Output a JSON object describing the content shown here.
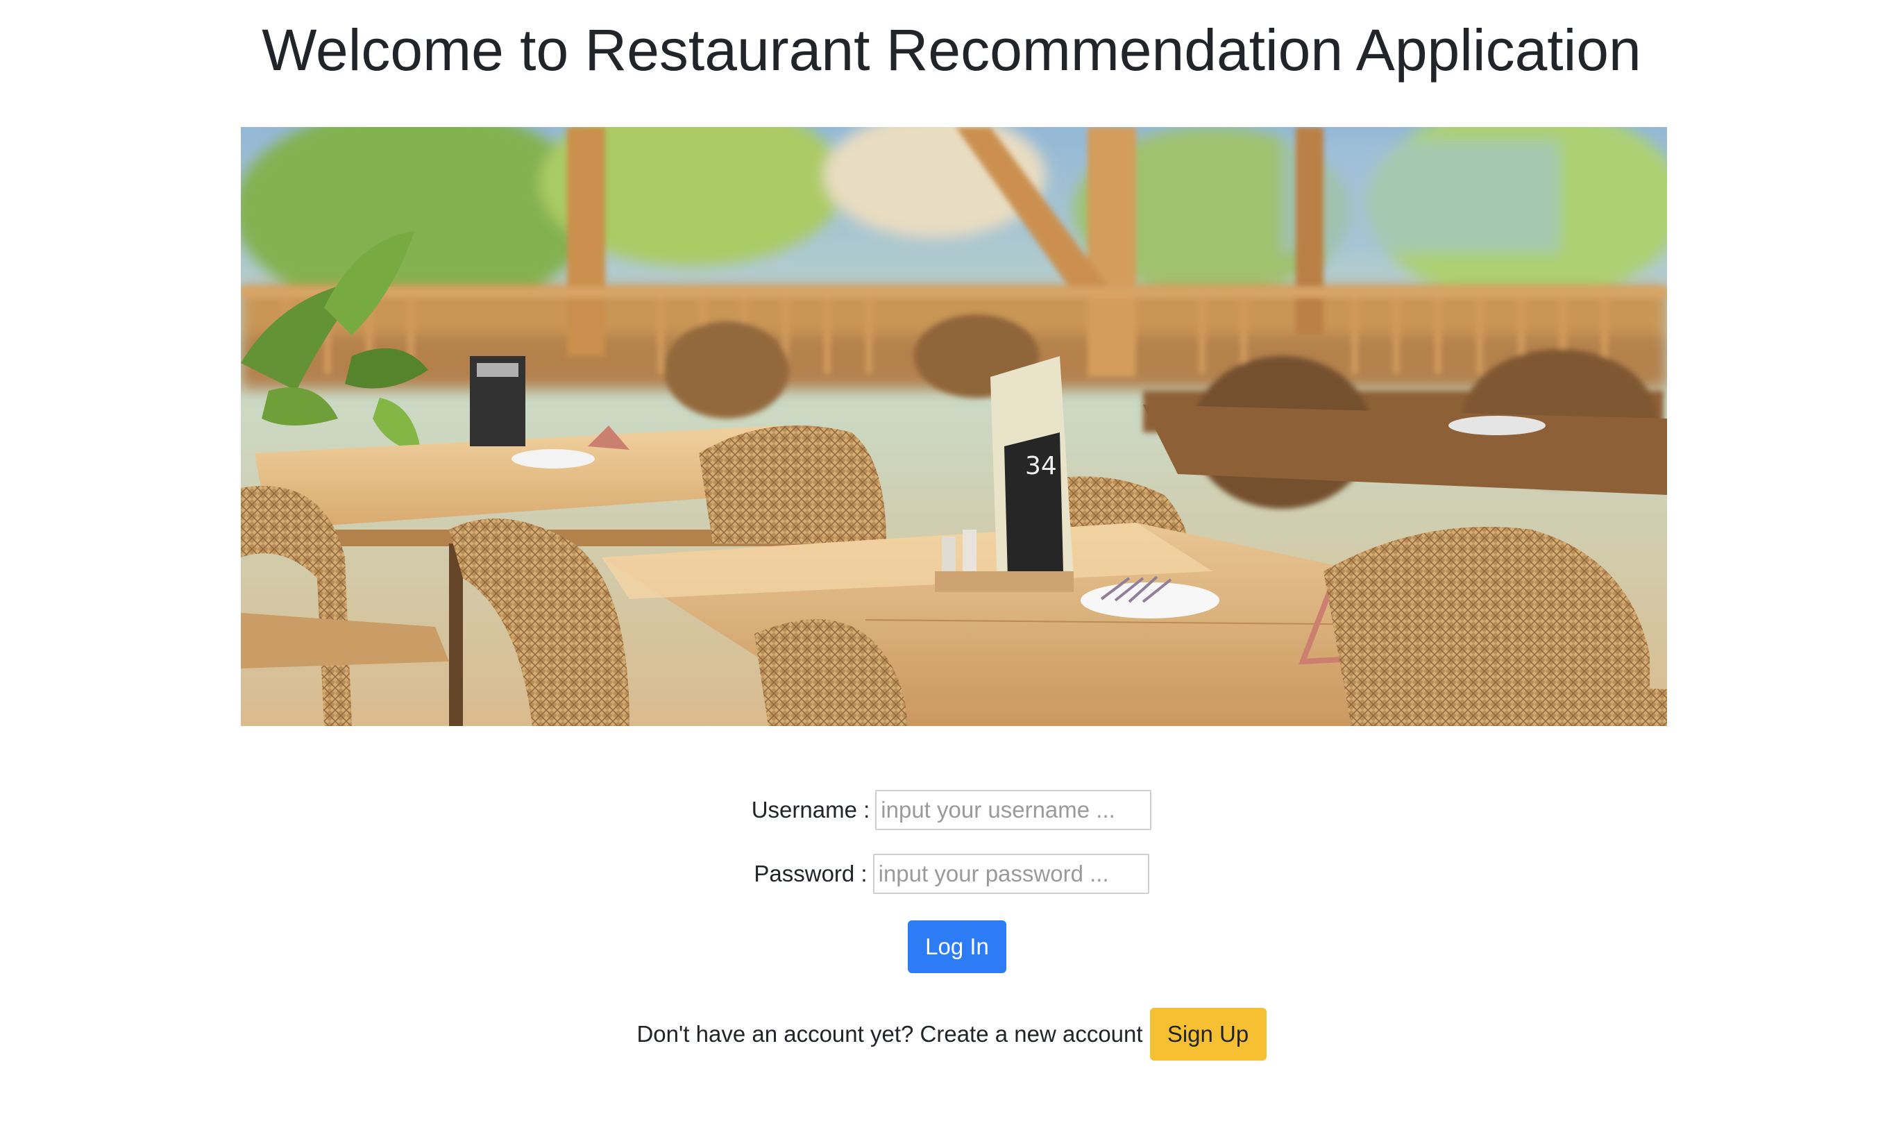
{
  "header": {
    "title": "Welcome to Restaurant Recommendation Application"
  },
  "login_form": {
    "username_label": "Username :",
    "username_placeholder": "input your username ...",
    "password_label": "Password :",
    "password_placeholder": "input your password ...",
    "login_button": "Log In"
  },
  "signup": {
    "prompt": "Don't have an account yet? Create a new account",
    "button": "Sign Up"
  },
  "colors": {
    "login_button": "#2d7cf6",
    "signup_button": "#f6c032",
    "text": "#212529"
  }
}
